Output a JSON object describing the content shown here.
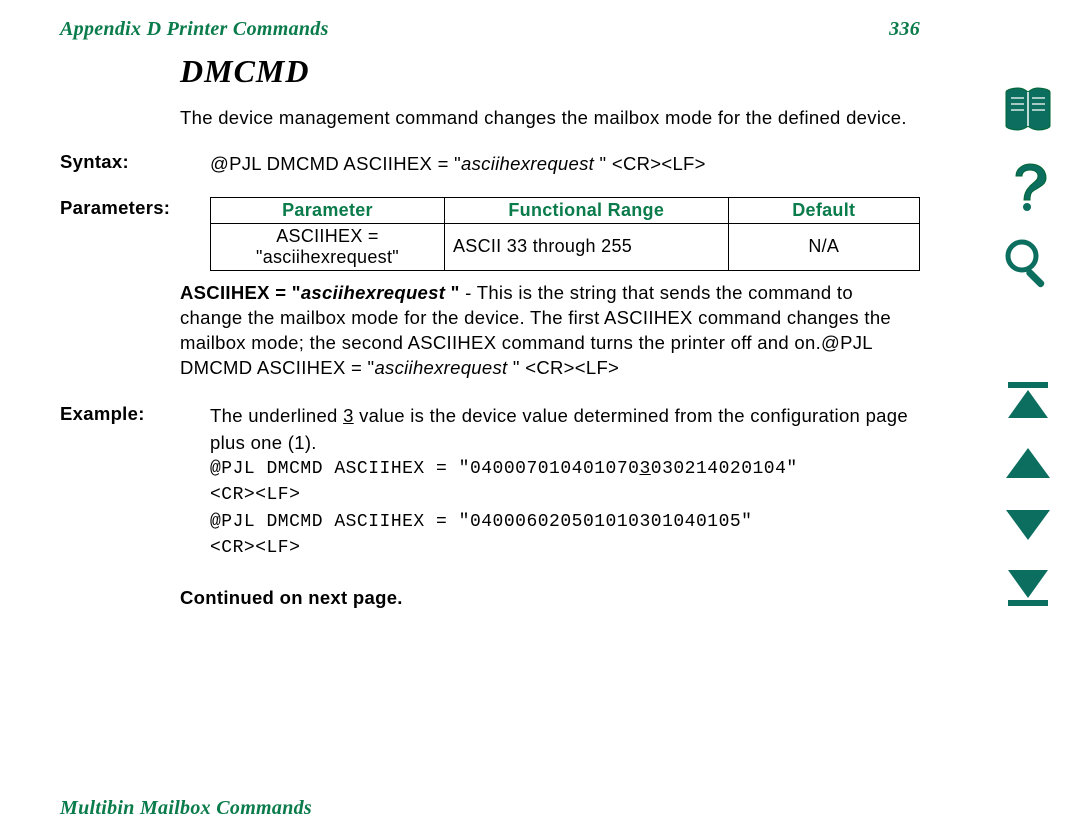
{
  "header": {
    "left": "Appendix D   Printer Commands",
    "page_number": "336"
  },
  "title": "DMCMD",
  "intro": "The device management command changes the mailbox mode for the defined device.",
  "labels": {
    "syntax": "Syntax:",
    "parameters": "Parameters:",
    "example": "Example:",
    "continued": "Continued on next page."
  },
  "syntax": {
    "prefix": "@PJL DMCMD ASCIIHEX = \"",
    "italic": "asciihexrequest ",
    "suffix": "\" <CR><LF>"
  },
  "table": {
    "headers": {
      "p": "Parameter",
      "r": "Functional Range",
      "d": "Default"
    },
    "row": {
      "p": "ASCIIHEX = \"asciihexrequest\"",
      "r": "ASCII 33 through 255",
      "d": "N/A"
    }
  },
  "param_desc": {
    "bold_prefix": "ASCIIHEX = \"",
    "bold_italic": "asciihexrequest ",
    "bold_suffix": "\"",
    "text1": " - This is the string that sends the command to change the mailbox mode for the device. The first ASCIIHEX command changes the mailbox mode; the second ASCIIHEX command turns the printer off and on.@PJL DMCMD ASCIIHEX = \"",
    "italic_mid": "asciihexrequest ",
    "text2": "\" <CR><LF>"
  },
  "example": {
    "intro_a": "The underlined ",
    "intro_u": "3",
    "intro_b": " value is the device value determined from the configuration page plus one (1).",
    "line1": "@PJL DMCMD ASCIIHEX = \"040007010401070",
    "line1_u": "3",
    "line1_b": "030214020104\"",
    "crlf": "<CR><LF>",
    "line2": "@PJL DMCMD ASCIIHEX = \"040006020501010301040105\""
  },
  "footer": "Multibin Mailbox Commands",
  "colors": {
    "teal": "#0b6e5e"
  }
}
